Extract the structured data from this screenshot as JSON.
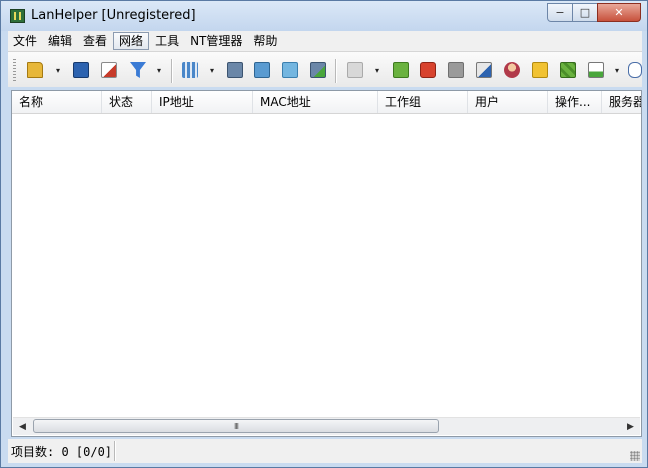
{
  "window": {
    "title": "LanHelper [Unregistered]"
  },
  "caption": {
    "minimize": "−",
    "restore": "□",
    "close": "✕"
  },
  "menu": [
    {
      "label": "文件"
    },
    {
      "label": "编辑"
    },
    {
      "label": "查看"
    },
    {
      "label": "网络"
    },
    {
      "label": "工具"
    },
    {
      "label": "NT管理器"
    },
    {
      "label": "帮助"
    }
  ],
  "toolbar": {
    "colors": {
      "open": "#e7b73a",
      "save": "#2d63b0",
      "delete": "#c73b2a",
      "filter": "#3a7bd5",
      "scan": "#4a87c9",
      "computer": "#6b87a8",
      "green": "#6ab23f",
      "red": "#d8432e",
      "gray": "#9a9a9a",
      "yellow": "#f1c232"
    },
    "dropdown_glyph": "▾"
  },
  "table": {
    "columns": [
      {
        "label": "名称"
      },
      {
        "label": "状态"
      },
      {
        "label": "IP地址"
      },
      {
        "label": "MAC地址"
      },
      {
        "label": "工作组"
      },
      {
        "label": "用户"
      },
      {
        "label": "操作..."
      },
      {
        "label": "服务器"
      }
    ]
  },
  "scrollbar": {
    "left": "◀",
    "right": "▶",
    "grip": "III"
  },
  "status": {
    "text": "项目数: 0 [0/0]"
  }
}
